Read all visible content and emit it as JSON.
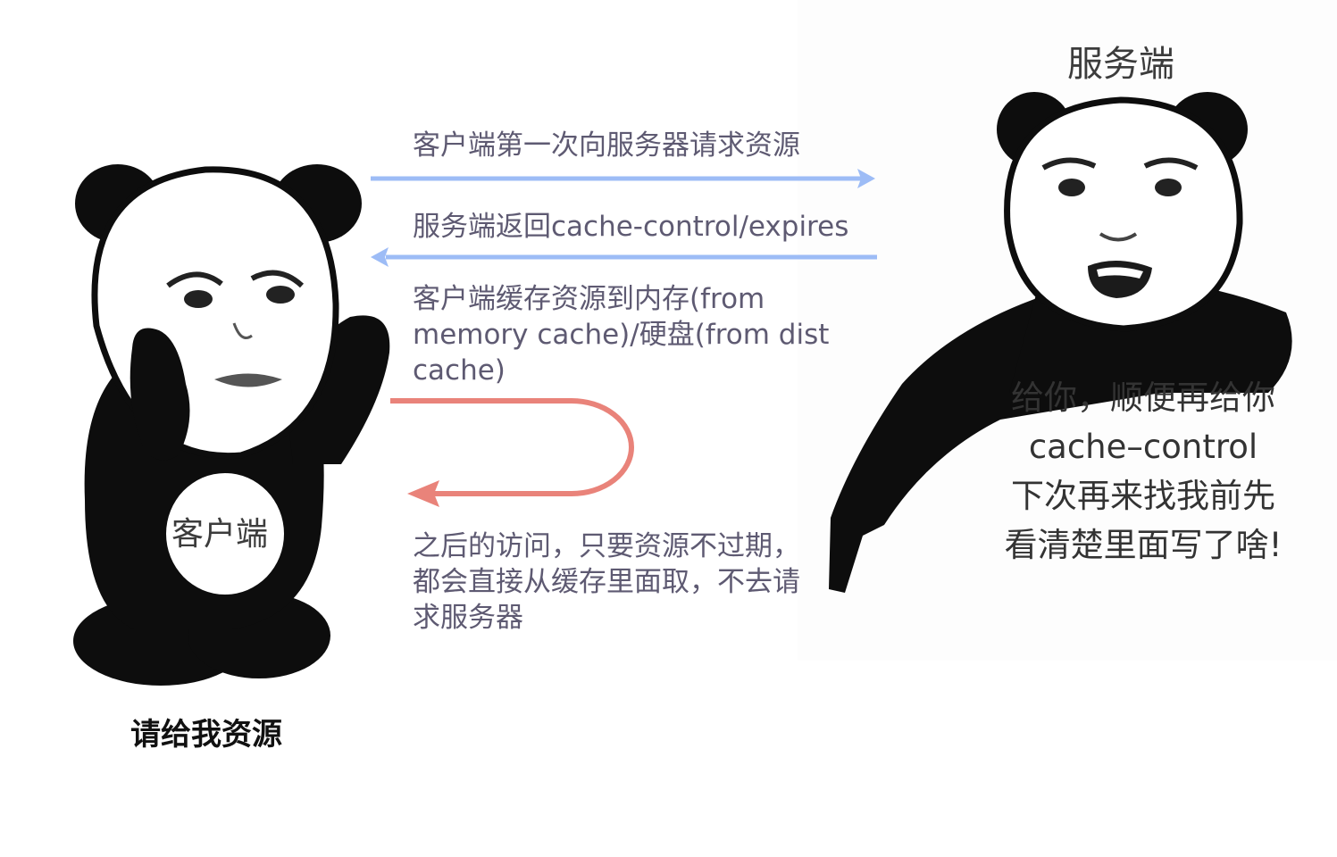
{
  "colors": {
    "request_arrow": "#9dbcf6",
    "response_arrow": "#9dbcf6",
    "cache_loop_arrow": "#e9837a",
    "step_text": "#5e5a72"
  },
  "client": {
    "figure_icon": "panda-meme-client",
    "body_label": "客户端",
    "caption": "请给我资源"
  },
  "server": {
    "figure_icon": "panda-meme-server",
    "title": "服务端",
    "speech_lines": [
      "给你，顺便再给你",
      "cache–control",
      "下次再来找我前先",
      "看清楚里面写了啥!"
    ]
  },
  "steps": {
    "request": "客户端第一次向服务器请求资源",
    "response": "服务端返回cache-control/expires",
    "cache_store": "客户端缓存资源到内存(from memory cache)/硬盘(from dist cache)",
    "cache_reuse": "之后的访问，只要资源不过期，都会直接从缓存里面取，不去请求服务器"
  }
}
